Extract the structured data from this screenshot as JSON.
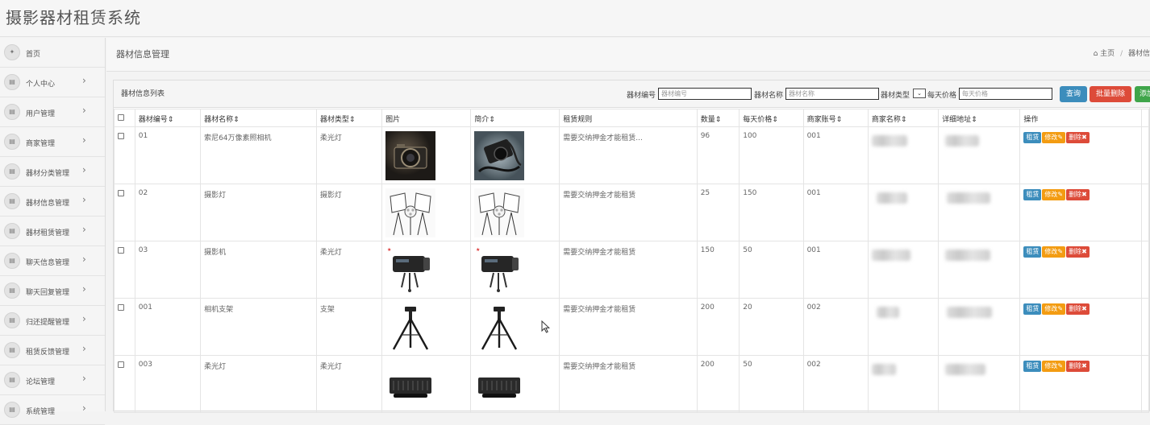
{
  "app": {
    "title": "摄影器材租赁系统"
  },
  "sidebar": {
    "items": [
      {
        "label": "首页",
        "icon": "home-icon",
        "chevron": false
      },
      {
        "label": "个人中心",
        "icon": "list-icon",
        "chevron": true
      },
      {
        "label": "用户管理",
        "icon": "list-icon",
        "chevron": true
      },
      {
        "label": "商家管理",
        "icon": "list-icon",
        "chevron": true
      },
      {
        "label": "器材分类管理",
        "icon": "list-icon",
        "chevron": true
      },
      {
        "label": "器材信息管理",
        "icon": "list-icon",
        "chevron": true
      },
      {
        "label": "器材租赁管理",
        "icon": "list-icon",
        "chevron": true
      },
      {
        "label": "聊天信息管理",
        "icon": "list-icon",
        "chevron": true
      },
      {
        "label": "聊天回复管理",
        "icon": "list-icon",
        "chevron": true
      },
      {
        "label": "归还提醒管理",
        "icon": "list-icon",
        "chevron": true
      },
      {
        "label": "租赁反馈管理",
        "icon": "list-icon",
        "chevron": true
      },
      {
        "label": "论坛管理",
        "icon": "list-icon",
        "chevron": true
      },
      {
        "label": "系统管理",
        "icon": "list-icon",
        "chevron": true
      }
    ],
    "home_glyph": "✦",
    "list_glyph": "▤",
    "chevron_glyph": "›"
  },
  "page": {
    "title": "器材信息管理",
    "breadcrumb": {
      "home": "主页",
      "current": "器材信"
    }
  },
  "panel": {
    "title": "器材信息列表"
  },
  "filters": {
    "code_label": "器材编号",
    "code_placeholder": "器材编号",
    "name_label": "器材名称",
    "name_placeholder": "器材名称",
    "type_label": "器材类型",
    "type_value": "⌄",
    "price_label": "每天价格",
    "price_placeholder": "每天价格",
    "search_button": "查询",
    "batch_delete_button": "批量删除",
    "add_button": "添加"
  },
  "table": {
    "columns": [
      "器材编号⇕",
      "器材名称⇕",
      "器材类型⇕",
      "图片",
      "简介⇕",
      "租赁规则",
      "数量⇕",
      "每天价格⇕",
      "商家账号⇕",
      "商家名称⇕",
      "详细地址⇕",
      "操作"
    ],
    "rows": [
      {
        "code": "01",
        "name": "索尼64万像素照相机",
        "type": "柔光灯",
        "image": "camera",
        "intro": "camera-bag",
        "rule": "需要交纳押金才能租赁...",
        "qty": "96",
        "price": "100",
        "merchant": "001"
      },
      {
        "code": "02",
        "name": "摄影灯",
        "type": "摄影灯",
        "image": "softbox",
        "intro": "softbox",
        "rule": "需要交纳押金才能租赁",
        "qty": "25",
        "price": "150",
        "merchant": "001"
      },
      {
        "code": "03",
        "name": "摄影机",
        "type": "柔光灯",
        "image": "strobe",
        "intro": "strobe",
        "rule": "需要交纳押金才能租赁",
        "qty": "150",
        "price": "50",
        "merchant": "001"
      },
      {
        "code": "001",
        "name": "相机支架",
        "type": "支架",
        "image": "tripod",
        "intro": "tripod",
        "rule": "需要交纳押金才能租赁",
        "qty": "200",
        "price": "20",
        "merchant": "002"
      },
      {
        "code": "003",
        "name": "柔光灯",
        "type": "柔光灯",
        "image": "panel-light",
        "intro": "panel-light",
        "rule": "需要交纳押金才能租赁",
        "qty": "200",
        "price": "50",
        "merchant": "002"
      }
    ],
    "actions": {
      "rent": "租赁",
      "edit": "修改✎",
      "delete": "删除✖"
    }
  },
  "colors": {
    "primary": "#3c8dbc",
    "danger": "#dd4b39",
    "success": "#3fa54a",
    "warning": "#f39c12"
  }
}
